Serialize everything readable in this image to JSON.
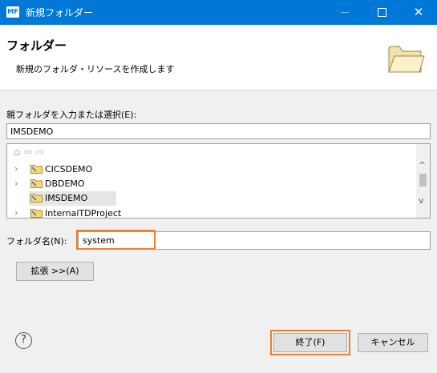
{
  "window": {
    "icon_text": "MF",
    "title": "新規フォルダー",
    "close_glyph": "✕"
  },
  "header": {
    "title": "フォルダー",
    "description": "新規のフォルダ・リソースを作成します",
    "icon": "folder-open-icon"
  },
  "parent": {
    "label": "親フォルダを入力または選択(E):",
    "value": "IMSDEMO"
  },
  "tree": {
    "toolbar": "⌂ ⇦ ⇨",
    "items": [
      {
        "label": "CICSDEMO",
        "expand": "›"
      },
      {
        "label": "DBDEMO",
        "expand": "›"
      },
      {
        "label": "IMSDEMO",
        "expand": "",
        "selected": true
      },
      {
        "label": "InternalTDProject",
        "expand": "›"
      }
    ],
    "scroll_up": "^",
    "scroll_down": "v"
  },
  "folder_name": {
    "label": "フォルダ名(N):",
    "value": "system"
  },
  "buttons": {
    "advanced": "拡張 >>(A)",
    "help": "?",
    "finish": "終了(F)",
    "cancel": "キャンセル"
  },
  "colors": {
    "titlebar": "#0078d7",
    "highlight": "#ed7d31"
  }
}
